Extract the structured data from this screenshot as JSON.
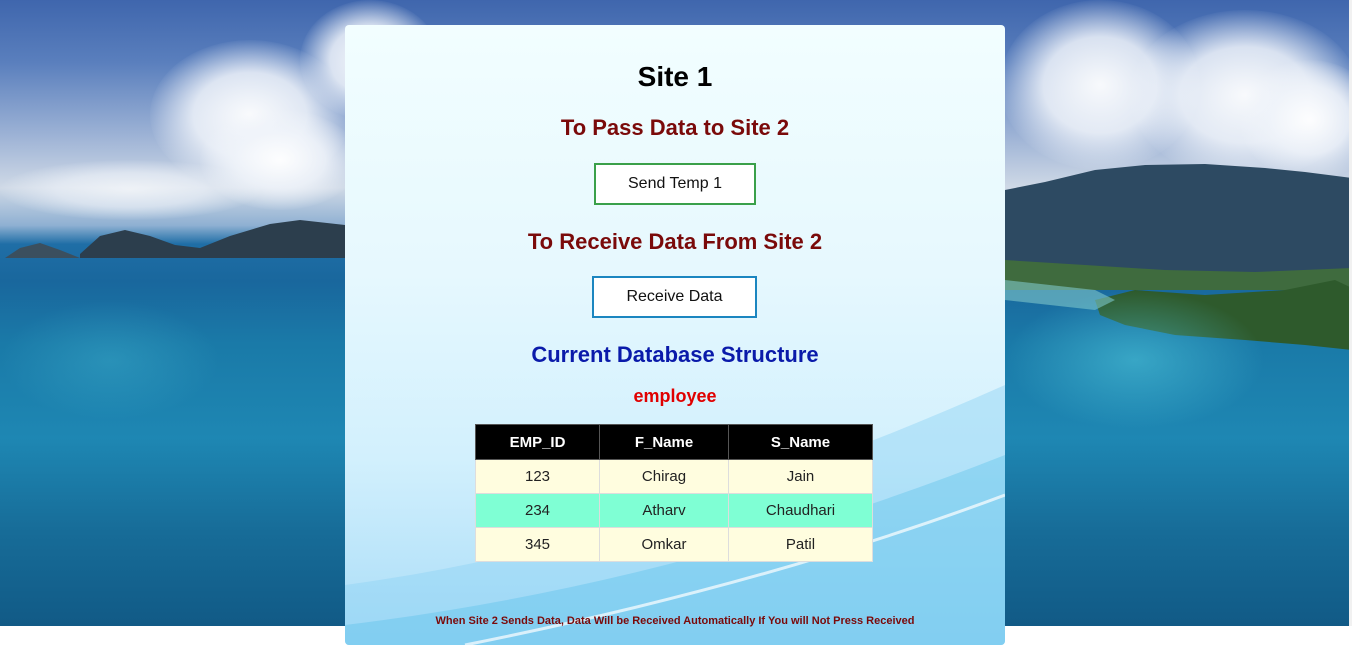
{
  "page": {
    "title": "Site 1",
    "pass_heading": "To Pass Data to Site 2",
    "send_button": "Send Temp 1",
    "receive_heading": "To Receive Data From Site 2",
    "receive_button": "Receive Data",
    "db_heading": "Current Database Structure",
    "table_name": "employee",
    "footnote": "When Site 2 Sends Data, Data Will be Received Automatically If You will Not Press Received"
  },
  "table": {
    "columns": [
      "EMP_ID",
      "F_Name",
      "S_Name"
    ],
    "rows": [
      [
        "123",
        "Chirag",
        "Jain"
      ],
      [
        "234",
        "Atharv",
        "Chaudhari"
      ],
      [
        "345",
        "Omkar",
        "Patil"
      ]
    ]
  },
  "colors": {
    "send_border": "#3aa04a",
    "receive_border": "#1b86c0",
    "heading_maroon": "#7a0a0a",
    "heading_blue": "#0a1aaa",
    "table_name_red": "#e00000",
    "row_odd": "#fffddf",
    "row_even": "#7fffd4"
  }
}
